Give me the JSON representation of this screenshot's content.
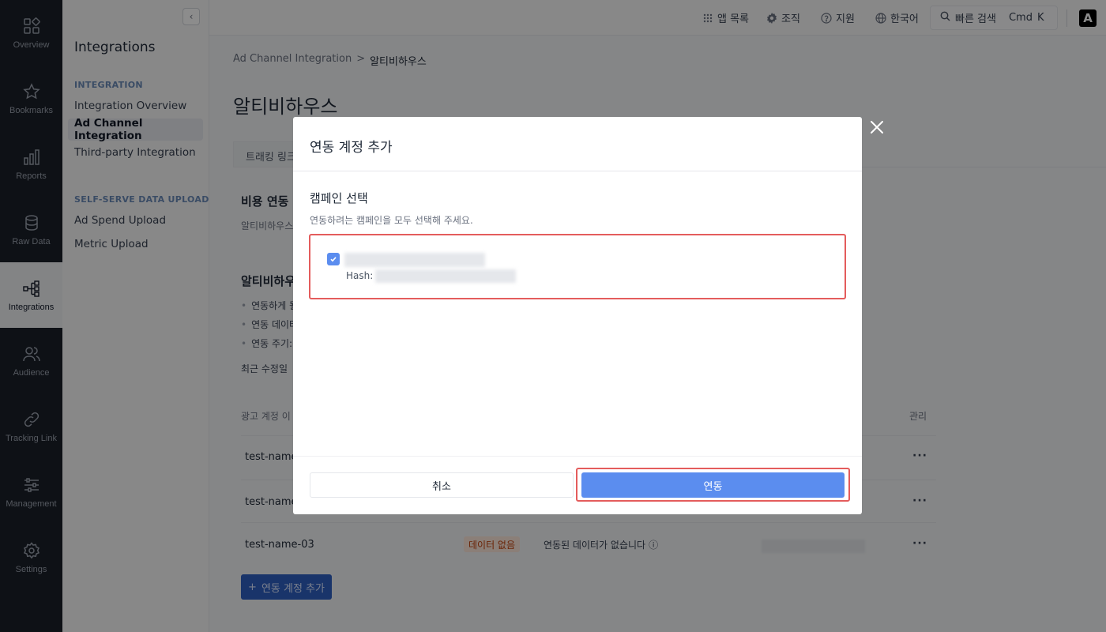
{
  "leftnav": {
    "items": [
      {
        "label": "Overview",
        "icon": "overview-icon"
      },
      {
        "label": "Bookmarks",
        "icon": "star-icon"
      },
      {
        "label": "Reports",
        "icon": "bar-chart-icon"
      },
      {
        "label": "Raw Data",
        "icon": "database-icon"
      },
      {
        "label": "Integrations",
        "icon": "integrations-icon"
      },
      {
        "label": "Audience",
        "icon": "users-icon"
      },
      {
        "label": "Tracking Link",
        "icon": "link-icon"
      },
      {
        "label": "Management",
        "icon": "sliders-icon"
      },
      {
        "label": "Settings",
        "icon": "gear-icon"
      }
    ],
    "active": "Integrations"
  },
  "sidebar": {
    "title": "Integrations",
    "collapse_glyph": "‹",
    "section_integration": "INTEGRATION",
    "items_integration": [
      "Integration Overview",
      "Ad Channel Integration",
      "Third-party Integration"
    ],
    "section_upload": "SELF-SERVE DATA UPLOAD",
    "items_upload": [
      "Ad Spend Upload",
      "Metric Upload"
    ]
  },
  "topbar": {
    "app_list": "앱 목록",
    "org": "조직",
    "support": "지원",
    "language": "한국어",
    "quick_search": "빠른 검색",
    "shortcut_cmd": "Cmd",
    "shortcut_key": "K",
    "logo": "A"
  },
  "main": {
    "breadcrumb_parent": "Ad Channel Integration",
    "breadcrumb_sep": ">",
    "breadcrumb_current": "알티비하우스",
    "page_title": "알티비하우스",
    "tab_label": "트래킹 링크",
    "section1_title": "비용 연동",
    "section1_desc": "알티비하우스",
    "section2_title": "알티비하우",
    "bullet1": "연동하게 될",
    "bullet2": "연동 데이터",
    "bullet3": "연동 주기:",
    "recent_modified": "최근 수정일",
    "col_account": "광고 계정 이",
    "col_manage": "관리",
    "rows": [
      {
        "name": "test-name"
      },
      {
        "name": "test-name"
      },
      {
        "name": "test-name-03",
        "badge": "데이터 없음",
        "info": "연동된 데이터가 없습니다"
      }
    ],
    "more_glyph": "···",
    "info_glyph": "ⓘ",
    "add_account_plus": "+",
    "add_account_button": "연동 계정 추가"
  },
  "modal": {
    "title": "연동 계정 추가",
    "section_title": "캠페인 선택",
    "section_desc": "연동하려는 캠페인을 모두 선택해 주세요.",
    "campaign_checked": true,
    "hash_label": "Hash:",
    "cancel_button": "취소",
    "connect_button": "연동"
  },
  "colors": {
    "primary": "#5b8def",
    "highlight": "#e45c5c",
    "nav_bg": "#1b2029",
    "badge_text": "#c2410c"
  }
}
